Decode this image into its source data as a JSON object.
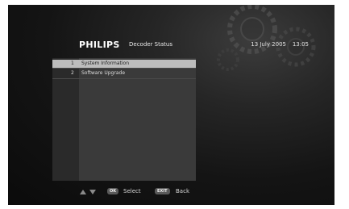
{
  "header": {
    "brand": "PHILIPS",
    "title": "Decoder Status",
    "date": "13 July 2005",
    "time": "13:05"
  },
  "menu": {
    "selected_index": 0,
    "items": [
      {
        "number": "1",
        "label": "System Information"
      },
      {
        "number": "2",
        "label": "Software Upgrade"
      }
    ]
  },
  "footer": {
    "nav_icon": "up-down-arrows-icon",
    "ok_key": "OK",
    "ok_label": "Select",
    "exit_key": "EXIT",
    "exit_label": "Back"
  },
  "colors": {
    "background": "#141414",
    "panel": "#3a3a3a",
    "highlight": "#bdbdbd",
    "text": "#e8e8e8"
  }
}
